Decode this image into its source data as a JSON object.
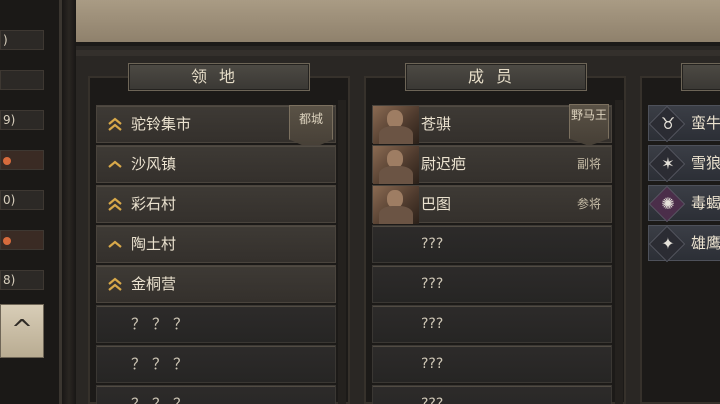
{
  "left_panel": {
    "rows": [
      {
        "text": ")",
        "orange": false
      },
      {
        "text": "",
        "orange": false
      },
      {
        "text": "9)",
        "orange": false
      },
      {
        "text": "",
        "orange": true
      },
      {
        "text": "0)",
        "orange": false
      },
      {
        "text": "",
        "orange": true
      },
      {
        "text": "8)",
        "orange": false
      }
    ],
    "up_button": "^"
  },
  "territory": {
    "header": "领地",
    "rows": [
      {
        "name": "驼铃集市",
        "rank": "double",
        "badge": "都城"
      },
      {
        "name": "沙风镇",
        "rank": "single",
        "badge": ""
      },
      {
        "name": "彩石村",
        "rank": "double",
        "badge": ""
      },
      {
        "name": "陶土村",
        "rank": "single",
        "badge": ""
      },
      {
        "name": "金桐营",
        "rank": "double",
        "badge": ""
      },
      {
        "name": "？？？",
        "rank": "none",
        "badge": ""
      },
      {
        "name": "？？？",
        "rank": "none",
        "badge": ""
      },
      {
        "name": "？？？",
        "rank": "none",
        "badge": ""
      }
    ]
  },
  "members": {
    "header": "成员",
    "rows": [
      {
        "name": "苍骐",
        "role": "野马王",
        "badge": true
      },
      {
        "name": "尉迟疤",
        "role": "副将",
        "badge": false
      },
      {
        "name": "巴图",
        "role": "参将",
        "badge": false
      },
      {
        "name": "???",
        "role": "",
        "badge": false
      },
      {
        "name": "???",
        "role": "",
        "badge": false
      },
      {
        "name": "???",
        "role": "",
        "badge": false
      },
      {
        "name": "???",
        "role": "",
        "badge": false
      },
      {
        "name": "???",
        "role": "",
        "badge": false
      }
    ]
  },
  "units": {
    "header": "",
    "rows": [
      {
        "name": "蛮牛",
        "icon": "bull-icon",
        "glyph": "♉",
        "color": "#2b2c33"
      },
      {
        "name": "雪狼",
        "icon": "wolf-icon",
        "glyph": "✶",
        "color": "#2b2c33"
      },
      {
        "name": "毒蝎",
        "icon": "scorpion-icon",
        "glyph": "✺",
        "color": "#4b2e4a"
      },
      {
        "name": "雄鹰",
        "icon": "eagle-icon",
        "glyph": "✦",
        "color": "#2b2c33"
      }
    ]
  }
}
